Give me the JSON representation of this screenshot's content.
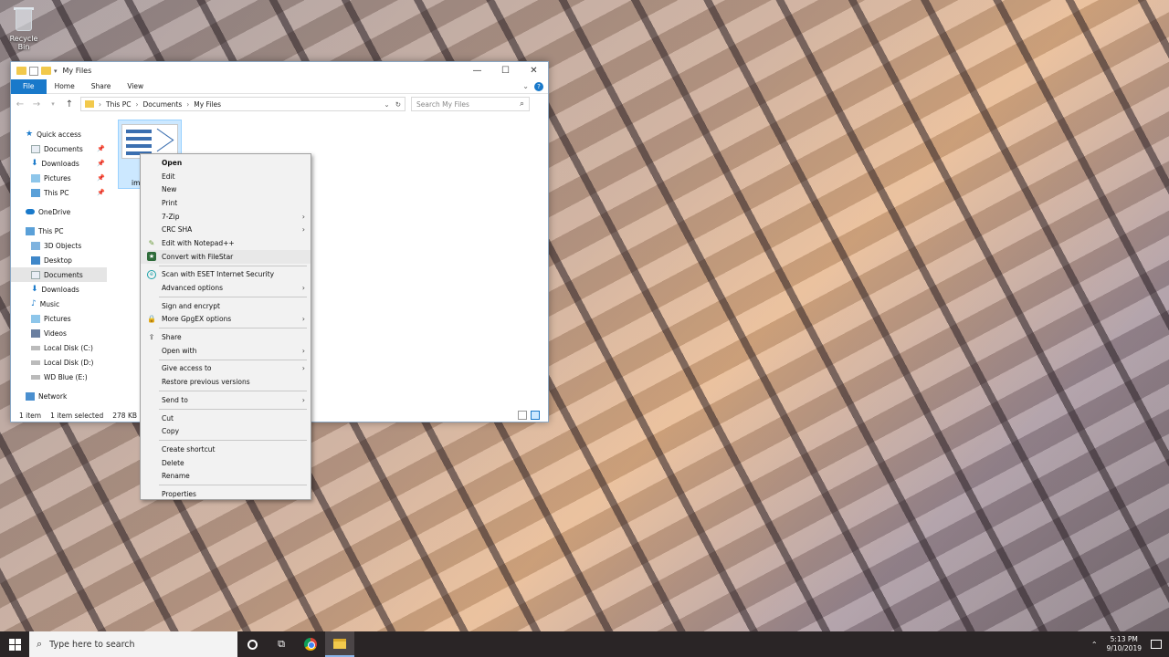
{
  "desktop": {
    "recycle_bin_label": "Recycle Bin"
  },
  "window": {
    "title": "My Files",
    "controls": {
      "minimize": "—",
      "maximize": "☐",
      "close": "✕"
    },
    "ribbon_tabs": [
      "File",
      "Home",
      "Share",
      "View"
    ],
    "help_label": "?",
    "address": {
      "crumbs": [
        "This PC",
        "Documents",
        "My Files"
      ],
      "separator": "›"
    },
    "search_placeholder": "Search My Files",
    "nav": {
      "quick_access": "Quick access",
      "qa_items": [
        "Documents",
        "Downloads",
        "Pictures",
        "This PC"
      ],
      "onedrive": "OneDrive",
      "this_pc": "This PC",
      "pc_items": [
        "3D Objects",
        "Desktop",
        "Documents",
        "Downloads",
        "Music",
        "Pictures",
        "Videos",
        "Local Disk (C:)",
        "Local Disk (D:)",
        "WD Blue (E:)"
      ],
      "network": "Network"
    },
    "file": {
      "name": "im"
    },
    "status": {
      "count": "1 item",
      "selected": "1 item selected",
      "size": "278 KB"
    }
  },
  "context_menu": {
    "items": [
      "Open",
      "Edit",
      "New",
      "Print",
      "7-Zip",
      "CRC SHA",
      "Edit with Notepad++",
      "Convert with FileStar",
      "Scan with ESET Internet Security",
      "Advanced options",
      "Sign and encrypt",
      "More GpgEX options",
      "Share",
      "Open with",
      "Give access to",
      "Restore previous versions",
      "Send to",
      "Cut",
      "Copy",
      "Create shortcut",
      "Delete",
      "Rename",
      "Properties"
    ]
  },
  "taskbar": {
    "search_placeholder": "Type here to search",
    "time": "5:13 PM",
    "date": "9/10/2019"
  }
}
